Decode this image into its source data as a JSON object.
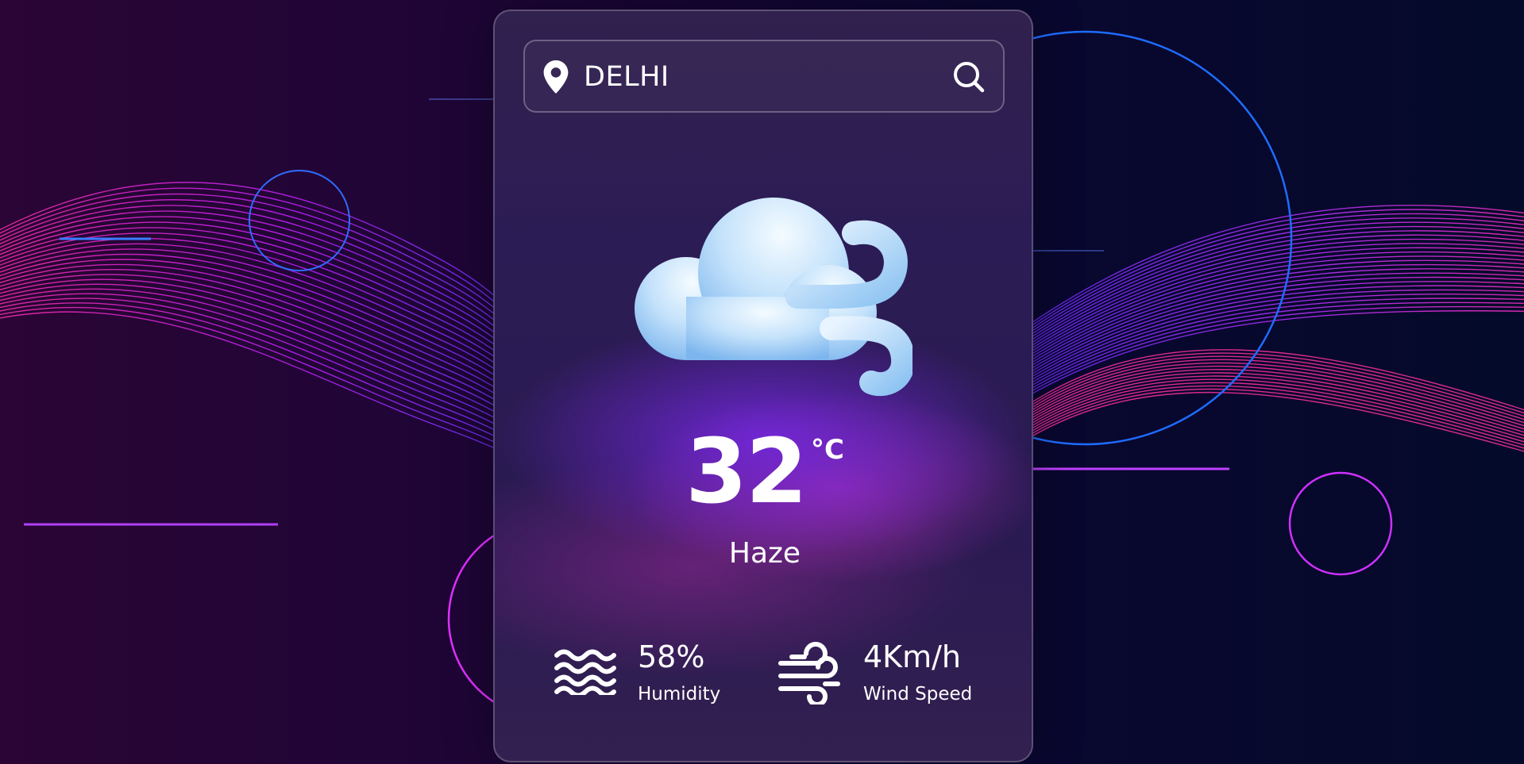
{
  "search": {
    "city_value": "DELHI",
    "pin_icon": "map-pin-icon",
    "search_icon": "search-icon"
  },
  "weather": {
    "icon": "cloud-wind-icon",
    "temperature": "32",
    "unit": "°C",
    "condition": "Haze"
  },
  "details": {
    "humidity": {
      "icon": "waves-icon",
      "value": "58%",
      "label": "Humidity"
    },
    "wind": {
      "icon": "wind-icon",
      "value": "4Km/h",
      "label": "Wind Speed"
    }
  },
  "colors": {
    "background_left": "#2a0535",
    "background_right": "#040a2a",
    "wave_pink": "#ff2fb8",
    "wave_blue": "#3b3bff",
    "ring_blue": "#1e6cff",
    "card_base": "#2c1c55",
    "text": "#ffffff"
  }
}
